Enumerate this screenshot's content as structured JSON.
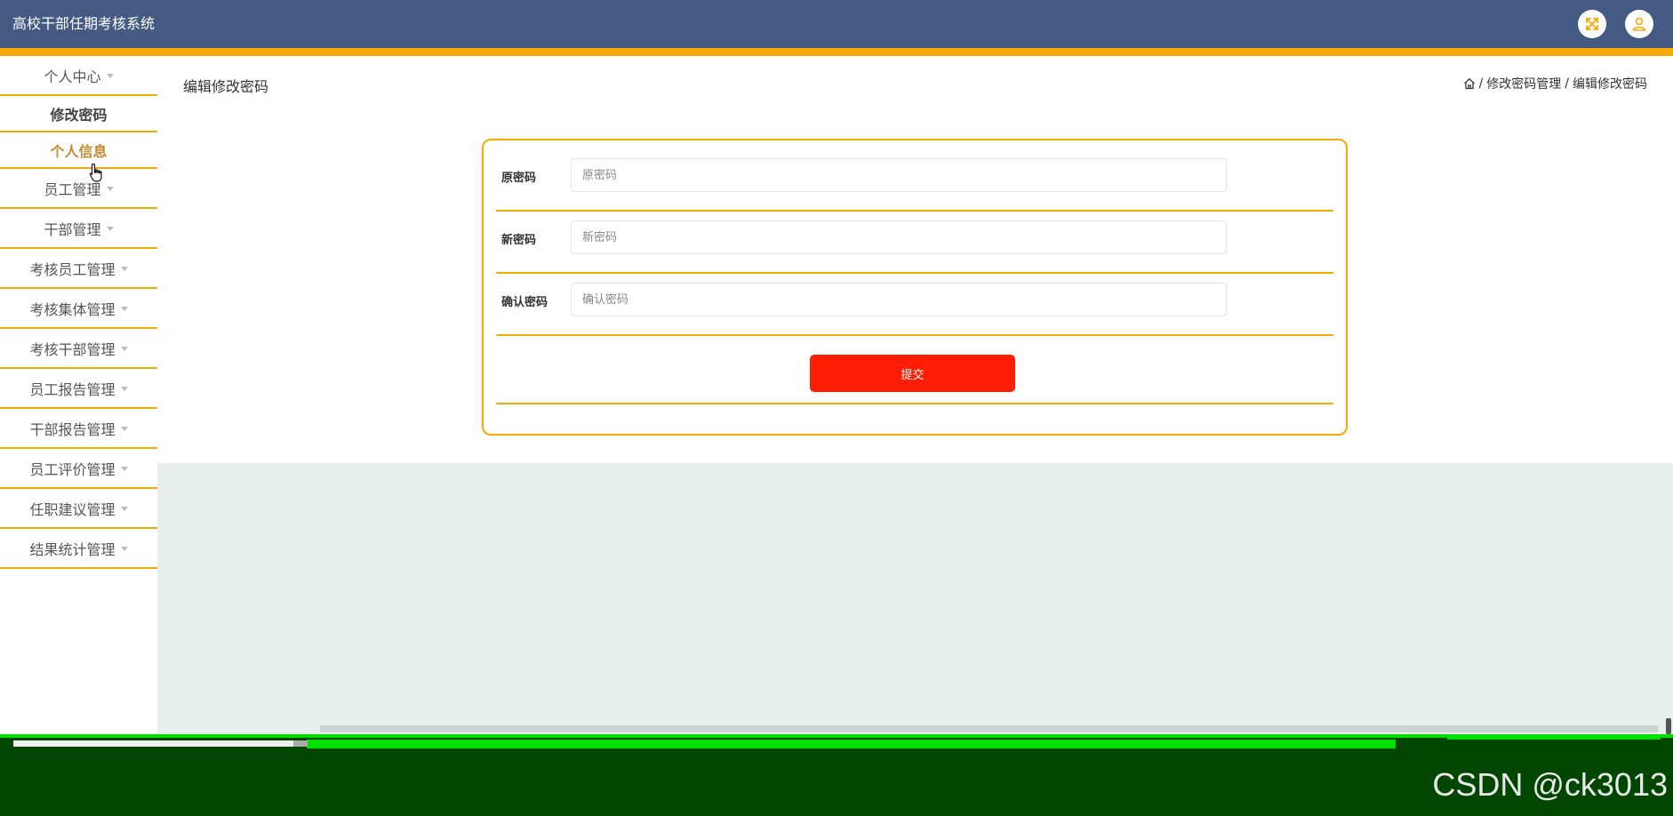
{
  "header": {
    "title": "高校干部任期考核系统",
    "icons": [
      "fullscreen-icon",
      "user-icon"
    ],
    "accent_color": "#f7a805",
    "bg_color": "#445a82"
  },
  "sidebar": {
    "items": [
      {
        "label": "个人中心",
        "has_caret": true
      },
      {
        "label": "修改密码",
        "sub": true
      },
      {
        "label": "个人信息",
        "sub": true,
        "active": true
      },
      {
        "label": "员工管理",
        "has_caret": true
      },
      {
        "label": "干部管理",
        "has_caret": true
      },
      {
        "label": "考核员工管理",
        "has_caret": true
      },
      {
        "label": "考核集体管理",
        "has_caret": true
      },
      {
        "label": "考核干部管理",
        "has_caret": true
      },
      {
        "label": "员工报告管理",
        "has_caret": true
      },
      {
        "label": "干部报告管理",
        "has_caret": true
      },
      {
        "label": "员工评价管理",
        "has_caret": true
      },
      {
        "label": "任职建议管理",
        "has_caret": true
      },
      {
        "label": "结果统计管理",
        "has_caret": true
      }
    ]
  },
  "main": {
    "page_title": "编辑修改密码",
    "breadcrumb": {
      "home_icon": "home-icon",
      "separator": "/",
      "items": [
        "修改密码管理",
        "编辑修改密码"
      ]
    }
  },
  "form": {
    "fields": [
      {
        "label": "原密码",
        "placeholder": "原密码",
        "value": ""
      },
      {
        "label": "新密码",
        "placeholder": "新密码",
        "value": ""
      },
      {
        "label": "确认密码",
        "placeholder": "确认密码",
        "value": ""
      }
    ],
    "submit_label": "提交",
    "submit_color": "#ff1e05"
  },
  "watermark": "CSDN @ck3013"
}
